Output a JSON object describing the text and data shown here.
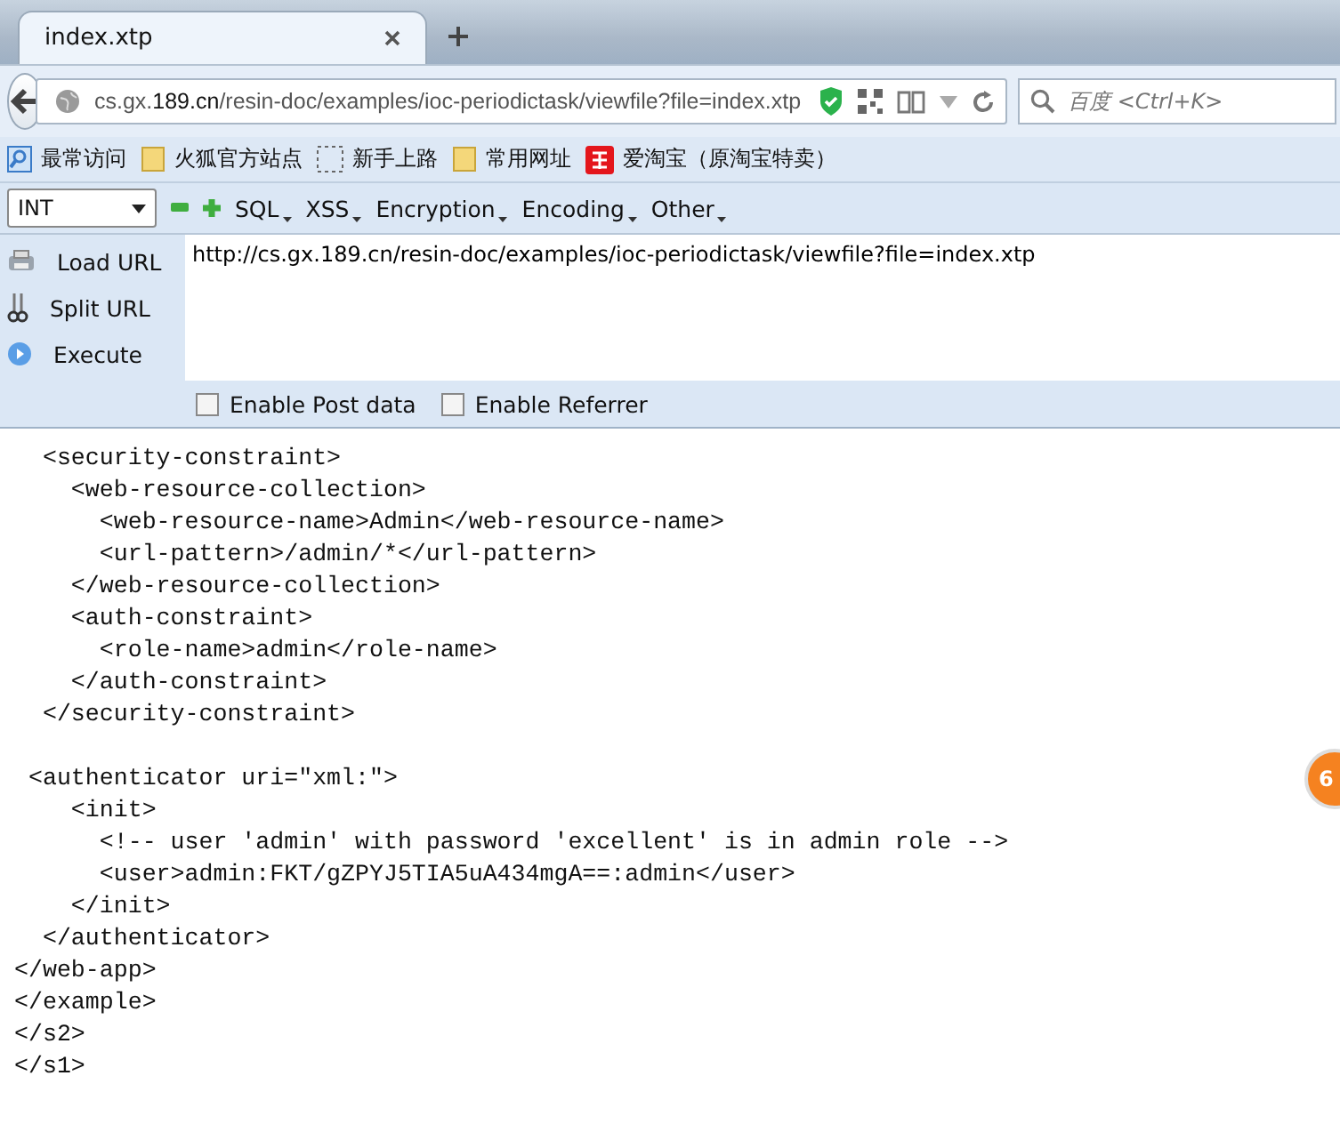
{
  "tabs": [
    {
      "title": "index.xtp",
      "selected": true
    }
  ],
  "address_bar": {
    "url_host_prefix": "cs.gx.",
    "url_host_domain": "189.cn",
    "url_path": "/resin-doc/examples/ioc-periodictask/viewfile?file=index.xtp"
  },
  "search": {
    "placeholder": "百度 <Ctrl+K>"
  },
  "bookmarks": [
    {
      "label": "最常访问",
      "kind": "smart"
    },
    {
      "label": "火狐官方站点",
      "kind": "folder"
    },
    {
      "label": "新手上路",
      "kind": "dashed"
    },
    {
      "label": "常用网址",
      "kind": "folder"
    },
    {
      "label": "爱淘宝（原淘宝特卖）",
      "kind": "taobao"
    }
  ],
  "hackbar": {
    "type_select": "INT",
    "menus": [
      "SQL",
      "XSS",
      "Encryption",
      "Encoding",
      "Other"
    ],
    "actions": [
      {
        "label": "Load URL",
        "kind": "load"
      },
      {
        "label": "Split URL",
        "kind": "split"
      },
      {
        "label": "Execute",
        "kind": "execute"
      }
    ],
    "url": "http://cs.gx.189.cn/resin-doc/examples/ioc-periodictask/viewfile?file=index.xtp",
    "options": [
      {
        "label": "Enable Post data",
        "checked": false
      },
      {
        "label": "Enable Referrer",
        "checked": false
      }
    ]
  },
  "code_blocks": [
    [
      "  <security-constraint>",
      "    <web-resource-collection>",
      "      <web-resource-name>Admin</web-resource-name>",
      "      <url-pattern>/admin/*</url-pattern>",
      "    </web-resource-collection>",
      "    <auth-constraint>",
      "      <role-name>admin</role-name>",
      "    </auth-constraint>",
      "  </security-constraint>"
    ],
    [
      " <authenticator uri=\"xml:\">",
      "    <init>",
      "      <!-- user 'admin' with password 'excellent' is in admin role -->",
      "      <user>admin:FKT/gZPYJ5TIA5uA434mgA==:admin</user>",
      "    </init>",
      "  </authenticator>",
      "</web-app>",
      "</example>",
      "</s2>",
      "</s1>"
    ]
  ],
  "floating_badge": "6"
}
